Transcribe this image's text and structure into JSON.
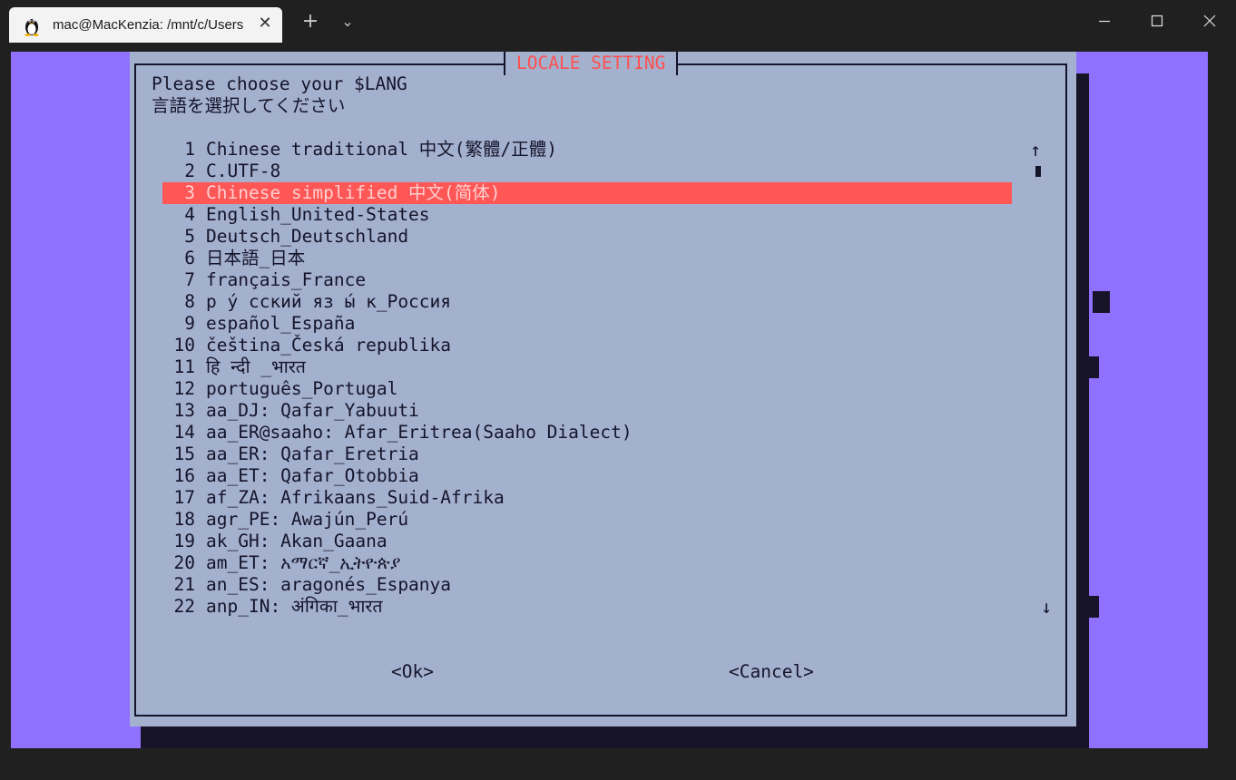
{
  "window": {
    "tab_title": "mac@MacKenzia: /mnt/c/Users",
    "tab_close_glyph": "✕",
    "new_tab_glyph": "+",
    "dropdown_glyph": "⌄"
  },
  "dialog": {
    "title": "LOCALE SETTING",
    "prompt_lines": [
      "Please choose your $LANG",
      "言語を選択してください"
    ],
    "items": [
      {
        "num": "1",
        "label": "Chinese traditional 中文(繁體/正體)"
      },
      {
        "num": "2",
        "label": "C.UTF-8"
      },
      {
        "num": "3",
        "label": "Chinese simplified 中文(简体)",
        "selected": true
      },
      {
        "num": "4",
        "label": "English_United-States"
      },
      {
        "num": "5",
        "label": "Deutsch_Deutschland"
      },
      {
        "num": "6",
        "label": "日本語_日本"
      },
      {
        "num": "7",
        "label": "français_France"
      },
      {
        "num": "8",
        "label": "р у́ сский яз ы́ к_Россия"
      },
      {
        "num": "9",
        "label": "español_España"
      },
      {
        "num": "10",
        "label": "čeština_Česká republika"
      },
      {
        "num": "11",
        "label": "हि न्दी _भारत"
      },
      {
        "num": "12",
        "label": "português_Portugal"
      },
      {
        "num": "13",
        "label": "aa_DJ: Qafar_Yabuuti"
      },
      {
        "num": "14",
        "label": "aa_ER@saaho: Afar_Eritrea(Saaho Dialect)"
      },
      {
        "num": "15",
        "label": "aa_ER: Qafar_Eretria"
      },
      {
        "num": "16",
        "label": "aa_ET: Qafar_Otobbia"
      },
      {
        "num": "17",
        "label": "af_ZA: Afrikaans_Suid-Afrika"
      },
      {
        "num": "18",
        "label": "agr_PE: Awajún_Perú"
      },
      {
        "num": "19",
        "label": "ak_GH: Akan_Gaana"
      },
      {
        "num": "20",
        "label": "am_ET: አማርኛ_ኢትዮጵያ"
      },
      {
        "num": "21",
        "label": "an_ES: aragonés_Espanya"
      },
      {
        "num": "22",
        "label": "anp_IN: अंगिका_भारत"
      }
    ],
    "scroll_up": "↑",
    "scroll_down": "↓",
    "ok_label": "<Ok>",
    "cancel_label": "<Cancel>"
  },
  "colors": {
    "terminal_bg": "#9070fe",
    "dialog_bg": "#a4b1ce",
    "title_red": "#ff5050",
    "selection_bg": "#ff5656"
  }
}
